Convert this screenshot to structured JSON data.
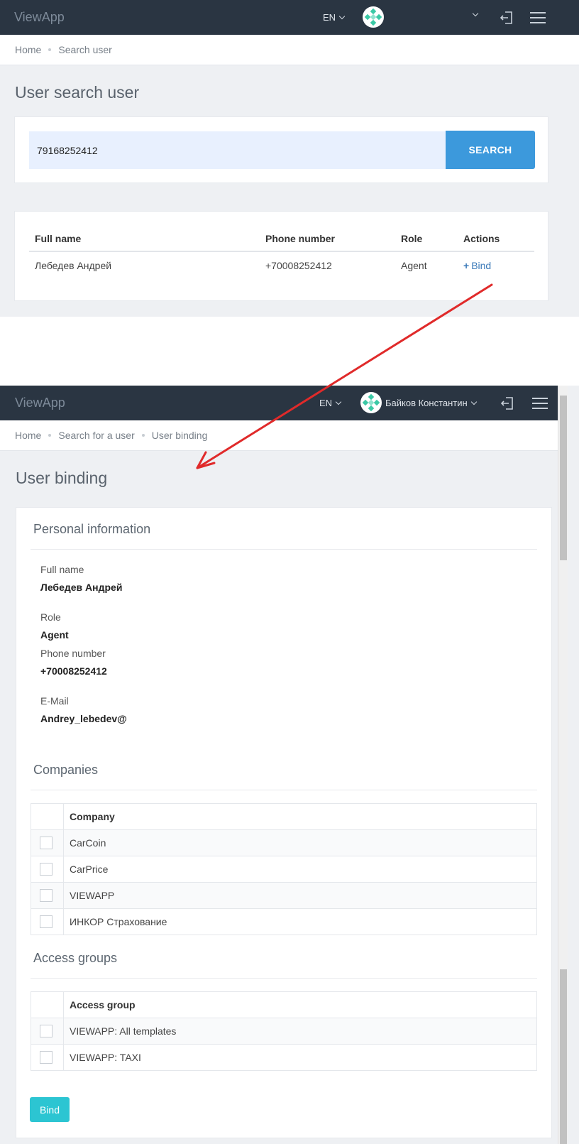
{
  "screen1": {
    "brand": "ViewApp",
    "language": "EN",
    "breadcrumb": [
      "Home",
      "Search user"
    ],
    "page_title": "User search user",
    "search": {
      "value": "79168252412",
      "button_label": "SEARCH"
    },
    "results": {
      "columns": [
        "Full name",
        "Phone number",
        "Role",
        "Actions"
      ],
      "rows": [
        {
          "full_name": "Лебедев Андрей",
          "phone": "+70008252412",
          "role": "Agent",
          "action": "Bind"
        }
      ]
    }
  },
  "screen2": {
    "brand": "ViewApp",
    "language": "EN",
    "user_name": "Байков Константин",
    "breadcrumb": [
      "Home",
      "Search for a user",
      "User binding"
    ],
    "page_title": "User binding",
    "personal": {
      "title": "Personal information",
      "full_name_label": "Full name",
      "full_name": "Лебедев Андрей",
      "role_label": "Role",
      "role": "Agent",
      "phone_label": "Phone number",
      "phone": "+70008252412",
      "email_label": "E-Mail",
      "email": "Andrey_lebedev@"
    },
    "companies": {
      "title": "Companies",
      "column": "Company",
      "rows": [
        "CarCoin",
        "CarPrice",
        "VIEWAPP",
        "ИНКОР Страхование"
      ]
    },
    "access_groups": {
      "title": "Access groups",
      "column": "Access group",
      "rows": [
        "VIEWAPP: All templates",
        "VIEWAPP: TAXI"
      ]
    },
    "bind_button": "Bind"
  },
  "colors": {
    "topbar": "#2a3542",
    "search_button": "#3c99dc",
    "bind_button": "#2cc5d2",
    "link": "#3a79b8",
    "arrow": "#e02a2a"
  }
}
